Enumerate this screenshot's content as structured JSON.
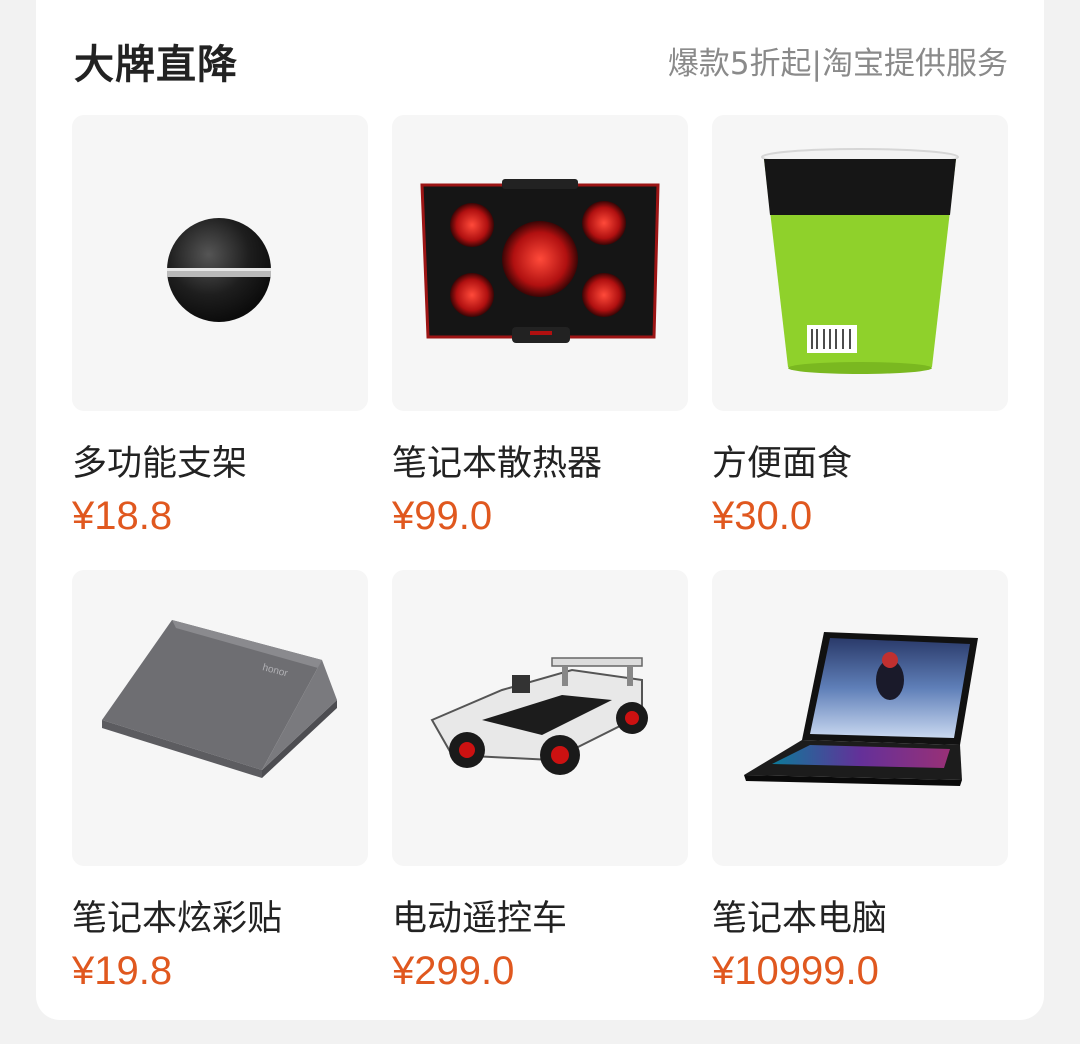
{
  "header": {
    "title": "大牌直降",
    "subtitle": "爆款5折起|淘宝提供服务"
  },
  "colors": {
    "price": "#e0581f",
    "thumb_bg": "#f6f6f6"
  },
  "products": [
    {
      "name": "多功能支架",
      "price": "¥18.8",
      "icon": "sphere-stand-image"
    },
    {
      "name": "笔记本散热器",
      "price": "¥99.0",
      "icon": "laptop-cooler-image"
    },
    {
      "name": "方便面食",
      "price": "¥30.0",
      "icon": "instant-noodle-cup-image"
    },
    {
      "name": "笔记本炫彩贴",
      "price": "¥19.8",
      "icon": "laptop-skin-image"
    },
    {
      "name": "电动遥控车",
      "price": "¥299.0",
      "icon": "rc-race-car-image"
    },
    {
      "name": "笔记本电脑",
      "price": "¥10999.0",
      "icon": "gaming-laptop-image"
    }
  ]
}
